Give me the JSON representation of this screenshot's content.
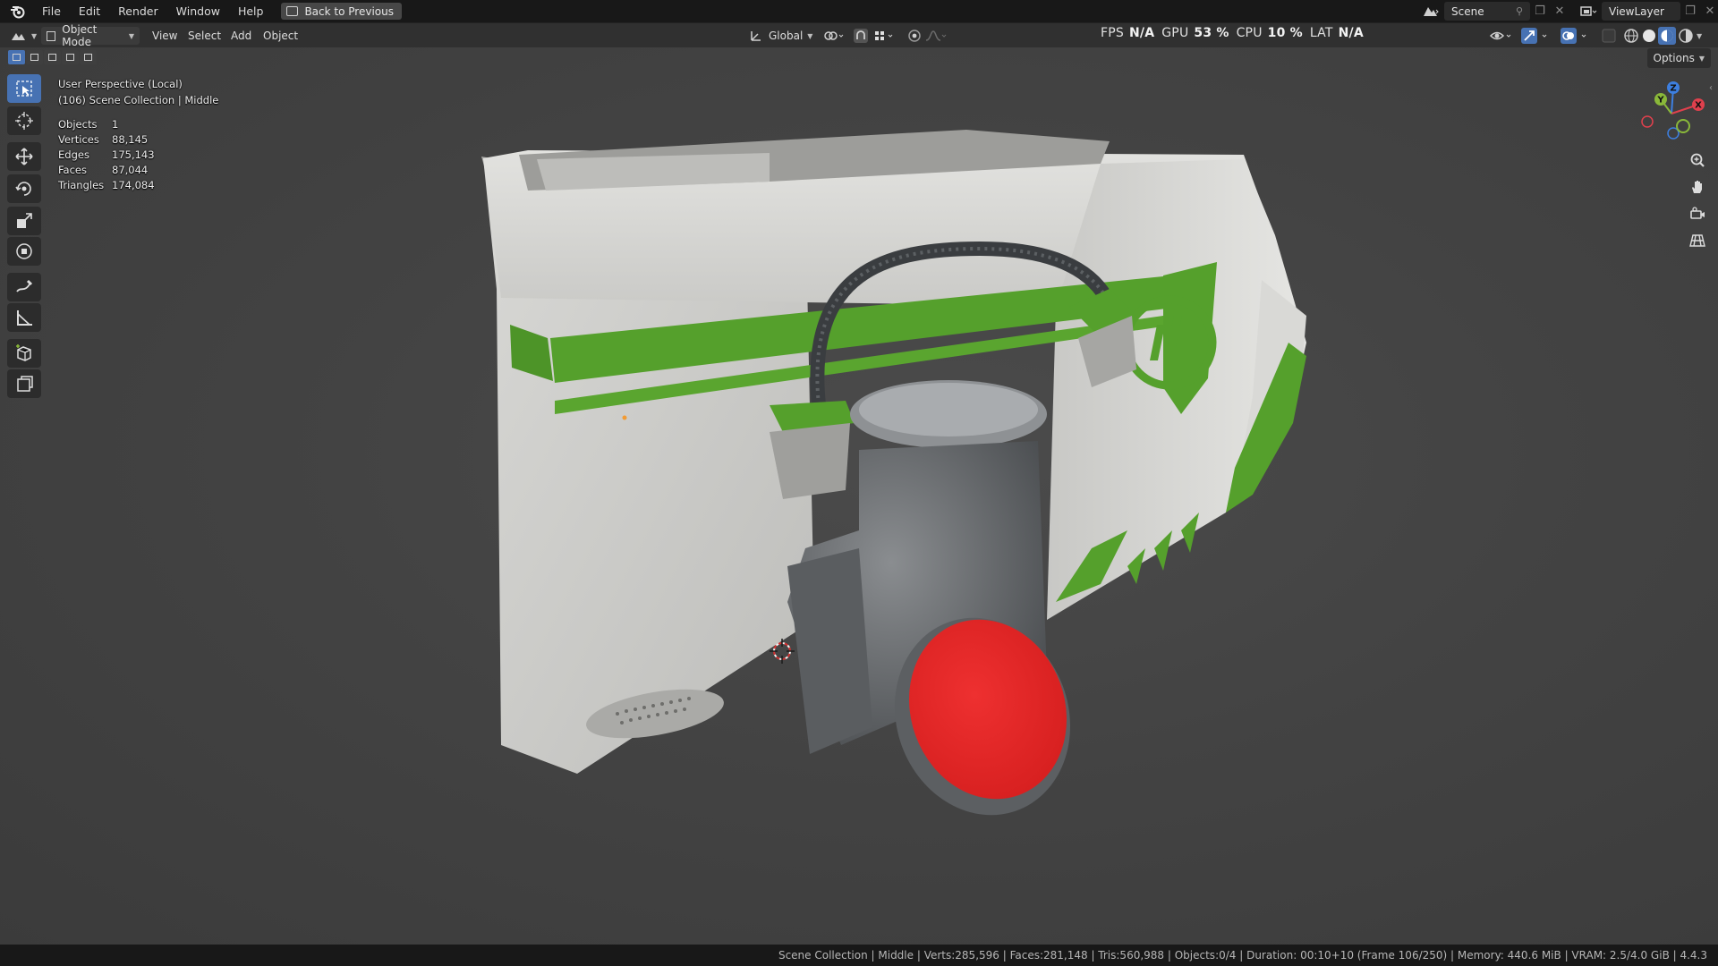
{
  "menu": {
    "items": [
      "File",
      "Edit",
      "Render",
      "Window",
      "Help"
    ],
    "back_button": "Back to Previous"
  },
  "workspace": {
    "scene_label": "Scene",
    "view_layer_label": "ViewLayer"
  },
  "viewport_header": {
    "mode": "Object Mode",
    "menus": [
      "View",
      "Select",
      "Add",
      "Object"
    ],
    "transform_orientation": "Global",
    "options_label": "Options"
  },
  "performance": {
    "fps_label": "FPS",
    "fps_value": "N/A",
    "gpu_label": "GPU",
    "gpu_value": "53 %",
    "cpu_label": "CPU",
    "cpu_value": "10 %",
    "lat_label": "LAT",
    "lat_value": "N/A"
  },
  "overlay": {
    "view_name": "User Perspective (Local)",
    "collection_line": "(106) Scene Collection | Middle",
    "stats": [
      {
        "label": "Objects",
        "value": "1"
      },
      {
        "label": "Vertices",
        "value": "88,145"
      },
      {
        "label": "Edges",
        "value": "175,143"
      },
      {
        "label": "Faces",
        "value": "87,044"
      },
      {
        "label": "Triangles",
        "value": "174,084"
      }
    ]
  },
  "gizmo": {
    "axes": [
      "Z",
      "Y",
      "X"
    ]
  },
  "colors": {
    "accent": "#4772b3",
    "model_white": "#d9d9d6",
    "model_green": "#55a02c",
    "model_red": "#e02424",
    "axis_x": "#e0404d",
    "axis_y": "#8ab83a",
    "axis_z": "#3d7fe0"
  },
  "status_bar": {
    "text": "Scene Collection | Middle | Verts:285,596 | Faces:281,148 | Tris:560,988 | Objects:0/4 | Duration: 00:10+10 (Frame 106/250) | Memory: 440.6 MiB | VRAM: 2.5/4.0 GiB | 4.4.3"
  }
}
